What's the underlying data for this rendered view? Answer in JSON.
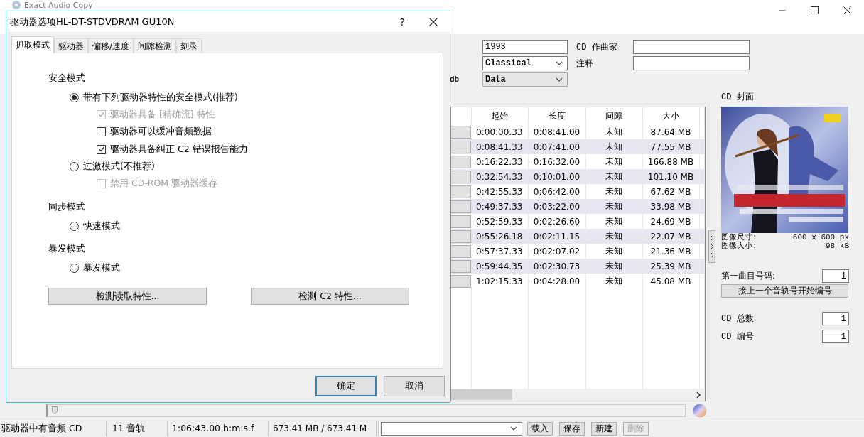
{
  "main_window": {
    "title": "Exact Audio Copy",
    "form": {
      "year": "1993",
      "genre": "Classical",
      "db_label": "db",
      "db_value": "Data",
      "composer_label": "CD 作曲家",
      "comment_label": "注释"
    },
    "tracks": {
      "columns": [
        "起始",
        "长度",
        "间隙",
        "大小"
      ],
      "rows": [
        {
          "start": "0:00:00.33",
          "length": "0:08:41.00",
          "gap": "未知",
          "size": "87.64 MB"
        },
        {
          "start": "0:08:41.33",
          "length": "0:07:41.00",
          "gap": "未知",
          "size": "77.55 MB"
        },
        {
          "start": "0:16:22.33",
          "length": "0:16:32.00",
          "gap": "未知",
          "size": "166.88 MB"
        },
        {
          "start": "0:32:54.33",
          "length": "0:10:01.00",
          "gap": "未知",
          "size": "101.10 MB"
        },
        {
          "start": "0:42:55.33",
          "length": "0:06:42.00",
          "gap": "未知",
          "size": "67.62 MB"
        },
        {
          "start": "0:49:37.33",
          "length": "0:03:22.00",
          "gap": "未知",
          "size": "33.98 MB"
        },
        {
          "start": "0:52:59.33",
          "length": "0:02:26.60",
          "gap": "未知",
          "size": "24.69 MB"
        },
        {
          "start": "0:55:26.18",
          "length": "0:02:11.15",
          "gap": "未知",
          "size": "22.07 MB"
        },
        {
          "start": "0:57:37.33",
          "length": "0:02:07.02",
          "gap": "未知",
          "size": "21.36 MB"
        },
        {
          "start": "0:59:44.35",
          "length": "0:02:30.73",
          "gap": "未知",
          "size": "25.39 MB"
        },
        {
          "start": "1:02:15.33",
          "length": "0:04:28.00",
          "gap": "未知",
          "size": "45.08 MB"
        }
      ]
    },
    "cover": {
      "label": "CD 封面",
      "info": [
        {
          "label": "图像尺寸:",
          "value": "600 x 600 px"
        },
        {
          "label": "图像大小:",
          "value": "98 kB"
        }
      ]
    },
    "first_track": {
      "label": "第一曲目号码:",
      "value": "1"
    },
    "continue_button": "接上一个音轨号开始编号",
    "cd_total": {
      "label": "CD 总数",
      "value": "1"
    },
    "cd_number": {
      "label": "CD 编号",
      "value": "1"
    },
    "position_slider": {
      "level": 0
    },
    "status_bar": [
      "驱动器中有音频 CD",
      "11 音轨",
      "1:06:43.00 h:m:s.f",
      "673.41 MB / 673.41 M"
    ],
    "profile_buttons": [
      {
        "label": "载入",
        "disabled": false
      },
      {
        "label": "保存",
        "disabled": false
      },
      {
        "label": "新建",
        "disabled": false
      },
      {
        "label": "删除",
        "disabled": true
      }
    ]
  },
  "dialog": {
    "title": "驱动器选项HL-DT-STDVDRAM GU10N",
    "help": "?",
    "tabs": [
      {
        "label": "抓取模式",
        "selected": true
      },
      {
        "label": "驱动器",
        "selected": false
      },
      {
        "label": "偏移/速度",
        "selected": false
      },
      {
        "label": "间隙检测",
        "selected": false
      },
      {
        "label": "刻录",
        "selected": false
      }
    ],
    "sections": [
      {
        "title": "安全模式",
        "options": [
          {
            "kind": "radio",
            "label": "带有下列驱动器特性的安全模式(推荐)",
            "selected": true,
            "children": [
              {
                "kind": "checkbox",
                "label": "驱动器具备 [精确流] 特性",
                "checked": true,
                "disabled": true
              },
              {
                "kind": "checkbox",
                "label": "驱动器可以缓冲音频数据",
                "checked": false,
                "disabled": false
              },
              {
                "kind": "checkbox",
                "label": "驱动器具备纠正 C2 错误报告能力",
                "checked": true,
                "disabled": false
              }
            ]
          },
          {
            "kind": "radio",
            "label": "过激模式(不推荐)",
            "selected": false,
            "children": [
              {
                "kind": "checkbox",
                "label": "禁用 CD-ROM 驱动器缓存",
                "checked": false,
                "disabled": true
              }
            ]
          }
        ]
      },
      {
        "title": "同步模式",
        "options": [
          {
            "kind": "radio",
            "label": "快速模式",
            "selected": false
          }
        ]
      },
      {
        "title": "暴发模式",
        "options": [
          {
            "kind": "radio",
            "label": "暴发模式",
            "selected": false
          }
        ]
      }
    ],
    "test_buttons": [
      "检测读取特性...",
      "检测 C2 特性..."
    ],
    "ok": "确定",
    "cancel": "取消"
  }
}
